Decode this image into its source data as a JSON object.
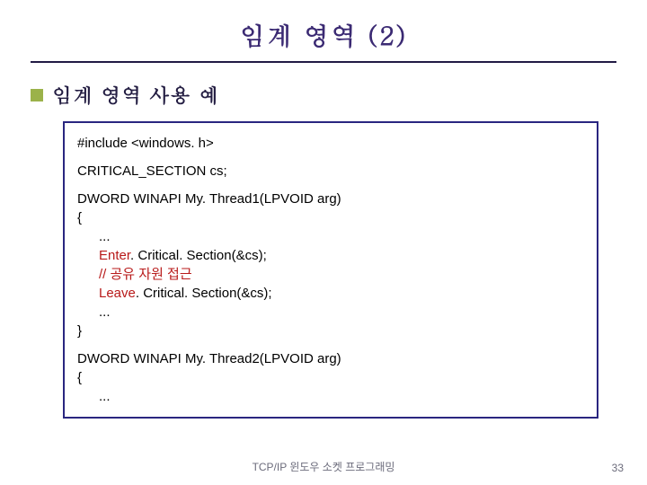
{
  "title": "임계 영역 (2)",
  "subtitle": "임계 영역 사용 예",
  "code": {
    "l1": "#include <windows. h>",
    "l2": "CRITICAL_SECTION cs;",
    "l3": "DWORD WINAPI My. Thread1(LPVOID arg)",
    "l4": "{",
    "l5": "...",
    "l6a": "Enter",
    "l6b": ". Critical. Section(&cs);",
    "l7": "// 공유 자원 접근",
    "l8a": "Leave",
    "l8b": ". Critical. Section(&cs);",
    "l9": "...",
    "l10": "}",
    "l11": "DWORD WINAPI My. Thread2(LPVOID arg)",
    "l12": "{",
    "l13": "..."
  },
  "footer": "TCP/IP 윈도우 소켓 프로그래밍",
  "page": "33",
  "colors": {
    "title": "#3b2a73",
    "bullet": "#9bb24a",
    "border": "#2a2680",
    "comment": "#b81a1a"
  }
}
